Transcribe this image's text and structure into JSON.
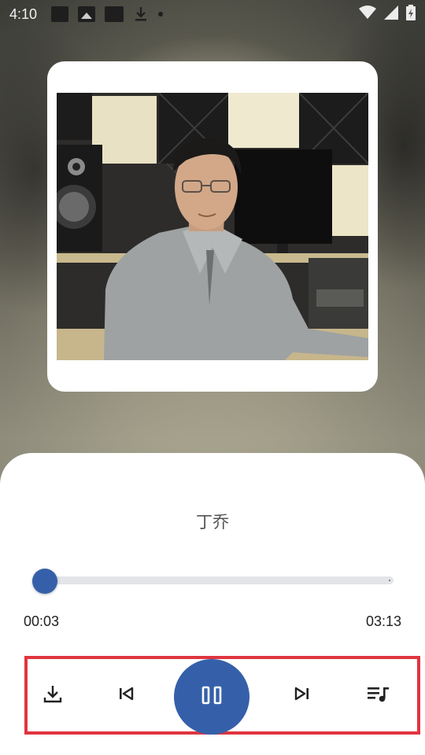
{
  "status_bar": {
    "time": "4:10",
    "icons_left": [
      "app-notification-icon",
      "image-icon",
      "media-icon",
      "download-icon",
      "dot-icon"
    ],
    "icons_right": [
      "wifi-icon",
      "cellular-signal-icon",
      "battery-icon"
    ]
  },
  "album": {
    "art_description_icon": "album-art-image"
  },
  "player": {
    "track_title": "丁乔",
    "elapsed": "00:03",
    "total": "03:13",
    "progress_fraction": 0.016
  },
  "controls": {
    "items": [
      "download-icon",
      "skip-previous-icon",
      "pause-icon",
      "skip-next-icon",
      "playlist-icon"
    ]
  },
  "colors": {
    "accent": "#3560a9",
    "highlight_border": "#e0343f"
  }
}
